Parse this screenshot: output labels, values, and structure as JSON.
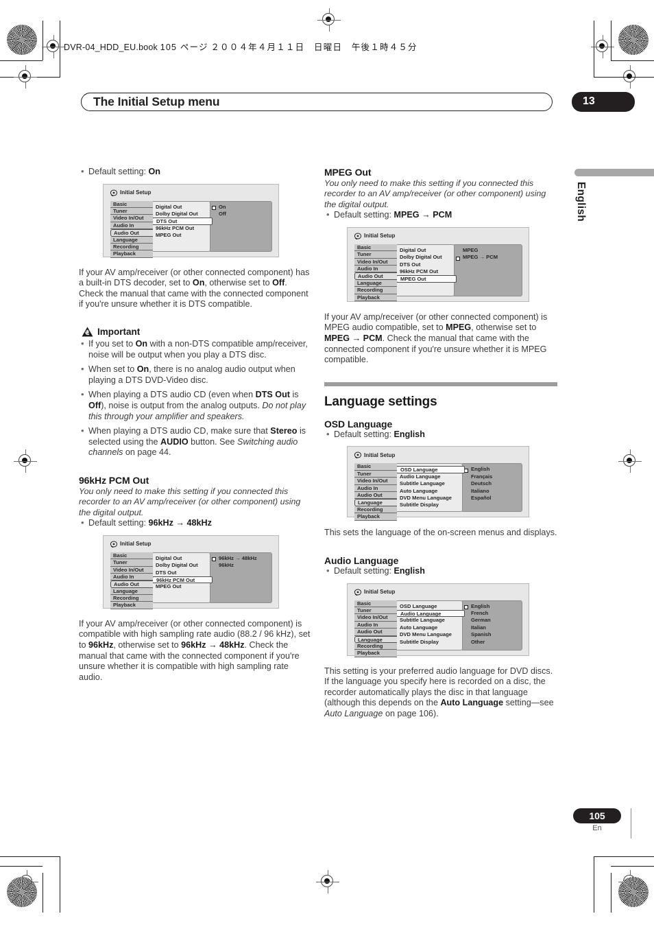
{
  "print_slug": {
    "filename": "DVR-04_HDD_EU.book",
    "page_note": "105 ページ",
    "date_note": "２００４年４月１１日　日曜日　午後１時４５分"
  },
  "header": {
    "title": "The Initial Setup menu",
    "chapter": "13"
  },
  "side_tab": {
    "language": "English"
  },
  "footer": {
    "page_number": "105",
    "page_language": "En"
  },
  "left_column": {
    "dts_default": {
      "prefix": "Default setting:",
      "value": "On"
    },
    "dts_figure": {
      "title": "Initial Setup",
      "nav": [
        "Basic",
        "Tuner",
        "Video In/Out",
        "Audio In",
        "Audio Out",
        "Language",
        "Recording",
        "Playback"
      ],
      "nav_selected": "Audio Out",
      "menu": [
        "Digital Out",
        "Dolby Digital Out",
        "DTS Out",
        "96kHz PCM Out",
        "MPEG Out"
      ],
      "menu_selected": "DTS Out",
      "options": [
        "On",
        "Off"
      ],
      "option_checked": "On"
    },
    "dts_body": [
      "If your AV amp/receiver (or other connected component) has a built-in DTS decoder, set to ",
      "On",
      ", otherwise set to ",
      "Off",
      ". Check the manual that came with the connected component if you're unsure whether it is DTS compatible."
    ],
    "important": {
      "label": "Important",
      "items": [
        {
          "parts": [
            {
              "t": "If you set to ",
              "s": "n"
            },
            {
              "t": "On",
              "s": "b"
            },
            {
              "t": " with a non-DTS compatible amp/receiver, noise will be output when you play a DTS disc.",
              "s": "n"
            }
          ]
        },
        {
          "parts": [
            {
              "t": "When set to ",
              "s": "n"
            },
            {
              "t": "On",
              "s": "b"
            },
            {
              "t": ", there is no analog audio output when playing a DTS DVD-Video disc.",
              "s": "n"
            }
          ]
        },
        {
          "parts": [
            {
              "t": "When playing a DTS audio CD (even when ",
              "s": "n"
            },
            {
              "t": "DTS Out",
              "s": "b"
            },
            {
              "t": " is ",
              "s": "n"
            },
            {
              "t": "Off",
              "s": "b"
            },
            {
              "t": "), noise is output from the analog outputs. ",
              "s": "n"
            },
            {
              "t": "Do not play this through your amplifier and speakers.",
              "s": "i"
            }
          ]
        },
        {
          "parts": [
            {
              "t": "When playing a DTS audio CD, make sure that ",
              "s": "n"
            },
            {
              "t": "Stereo",
              "s": "b"
            },
            {
              "t": " is selected using the ",
              "s": "n"
            },
            {
              "t": "AUDIO",
              "s": "b"
            },
            {
              "t": " button. See ",
              "s": "n"
            },
            {
              "t": "Switching audio channels",
              "s": "i"
            },
            {
              "t": " on page 44.",
              "s": "n"
            }
          ]
        }
      ]
    },
    "pcm_section": {
      "heading": "96kHz PCM Out",
      "lead": "You only need to make this setting if you connected this recorder to an AV amp/receiver (or other component) using the digital output.",
      "default_prefix": "Default setting:",
      "default_value": "96kHz → 48kHz"
    },
    "pcm_figure": {
      "title": "Initial Setup",
      "nav": [
        "Basic",
        "Tuner",
        "Video In/Out",
        "Audio In",
        "Audio Out",
        "Language",
        "Recording",
        "Playback"
      ],
      "nav_selected": "Audio Out",
      "menu": [
        "Digital Out",
        "Dolby Digital Out",
        "DTS Out",
        "96kHz PCM Out",
        "MPEG Out"
      ],
      "menu_selected": "96kHz PCM Out",
      "options": [
        "96kHz → 48kHz",
        "96kHz"
      ],
      "option_checked": "96kHz → 48kHz"
    },
    "pcm_body": [
      "If your AV amp/receiver (or other connected component) is compatible with high sampling rate audio (88.2 / 96 kHz), set to ",
      "96kHz",
      ", otherwise set to ",
      "96kHz → 48kHz",
      ". Check the manual that came with the connected component if you're unsure whether it is compatible with high sampling rate audio."
    ]
  },
  "right_column": {
    "mpeg_section": {
      "heading": "MPEG Out",
      "lead": "You only need to make this setting if you connected this recorder to an AV amp/receiver (or other component) using the digital output.",
      "default_prefix": "Default setting:",
      "default_value": "MPEG → PCM"
    },
    "mpeg_figure": {
      "title": "Initial Setup",
      "nav": [
        "Basic",
        "Tuner",
        "Video In/Out",
        "Audio In",
        "Audio Out",
        "Language",
        "Recording",
        "Playback"
      ],
      "nav_selected": "Audio Out",
      "menu": [
        "Digital Out",
        "Dolby Digital Out",
        "DTS Out",
        "96kHz PCM Out",
        "MPEG Out"
      ],
      "menu_selected": "MPEG Out",
      "options": [
        "MPEG",
        "MPEG → PCM"
      ],
      "option_checked": "MPEG → PCM"
    },
    "mpeg_body": [
      "If your AV amp/receiver (or other connected component) is MPEG audio compatible, set to ",
      "MPEG",
      ", otherwise set to ",
      "MPEG → PCM",
      ". Check the manual that came with the connected component if you're unsure whether it is MPEG compatible."
    ],
    "language_settings_heading": "Language settings",
    "osd_section": {
      "heading": "OSD Language",
      "default_prefix": "Default setting:",
      "default_value": "English"
    },
    "osd_figure": {
      "title": "Initial Setup",
      "nav": [
        "Basic",
        "Tuner",
        "Video In/Out",
        "Audio In",
        "Audio Out",
        "Language",
        "Recording",
        "Playback"
      ],
      "nav_selected": "Language",
      "menu": [
        "OSD Language",
        "Audio Language",
        "Subtitle Language",
        "Auto Language",
        "DVD Menu Language",
        "Subtitle Display"
      ],
      "menu_selected": "OSD Language",
      "options": [
        "English",
        "Français",
        "Deutsch",
        "Italiano",
        "Español"
      ],
      "option_checked": "English"
    },
    "osd_body": "This sets the language of the on-screen menus and displays.",
    "audio_lang_section": {
      "heading": "Audio Language",
      "default_prefix": "Default setting:",
      "default_value": "English"
    },
    "audio_lang_figure": {
      "title": "Initial Setup",
      "nav": [
        "Basic",
        "Tuner",
        "Video In/Out",
        "Audio In",
        "Audio Out",
        "Language",
        "Recording",
        "Playback"
      ],
      "nav_selected": "Language",
      "menu": [
        "OSD Language",
        "Audio Language",
        "Subtitle Language",
        "Auto Language",
        "DVD Menu Language",
        "Subtitle Display"
      ],
      "menu_selected": "Audio Language",
      "options": [
        "English",
        "French",
        "German",
        "Italian",
        "Spanish",
        "Other"
      ],
      "option_checked": "English"
    },
    "audio_lang_body": [
      "This setting is your preferred audio language for DVD discs. If the language you specify here is recorded on a disc, the recorder automatically plays the disc in that language (although this depends on the ",
      "Auto Language",
      " setting—see ",
      "Auto Language",
      " on page 106)."
    ]
  },
  "colors": {
    "ink": "#231f20",
    "body_text": "#3b3b3b",
    "rule_gray": "#9c9c9c",
    "osd_bg": "#e7e7e7",
    "osd_nav": "#c9c9c9",
    "osd_panel": "#a8a8a8"
  }
}
